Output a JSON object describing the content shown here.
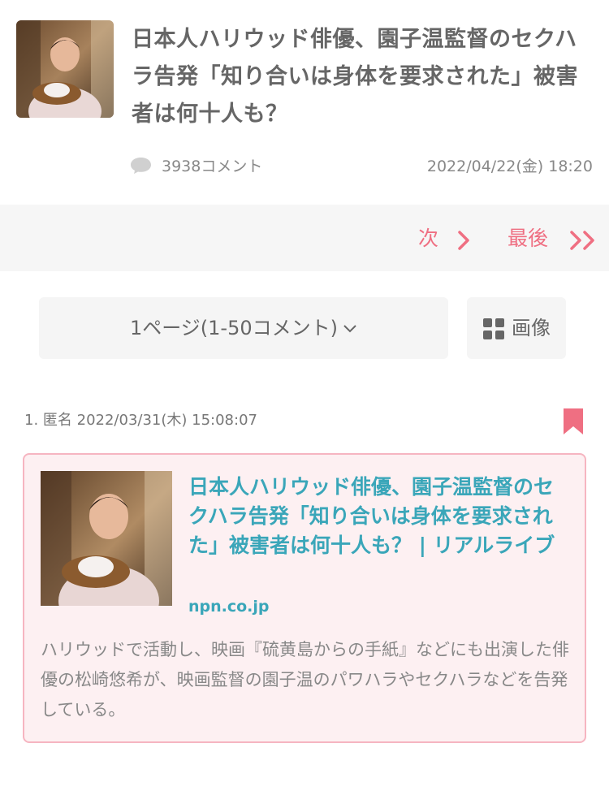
{
  "article": {
    "title": "日本人ハリウッド俳優、園子温監督のセクハラ告発「知り合いは身体を要求された」被害者は何十人も？",
    "comment_count": "3938コメント",
    "date": "2022/04/22(金) 18:20"
  },
  "nav": {
    "next_label": "次",
    "last_label": "最後",
    "accent_color": "#ef6f82"
  },
  "pager": {
    "selected": "1ページ(1-50コメント)",
    "image_label": "画像"
  },
  "comment": {
    "header": "1. 匿名 2022/03/31(木) 15:08:07",
    "link_card": {
      "title": "日本人ハリウッド俳優、園子温監督のセクハラ告発「知り合いは身体を要求された」被害者は何十人も？ | リアルライブ",
      "domain": "npn.co.jp",
      "description": "ハリウッドで活動し、映画『硫黄島からの手紙』などにも出演した俳優の松崎悠希が、映画監督の園子温のパワハラやセクハラなどを告発している。"
    }
  },
  "icons": {
    "comment": "comment-bubble-icon",
    "chevron": "chevron-right-icon",
    "double_chevron": "double-chevron-right-icon",
    "dropdown": "chevron-down-icon",
    "grid": "grid-icon",
    "bookmark": "bookmark-icon"
  }
}
